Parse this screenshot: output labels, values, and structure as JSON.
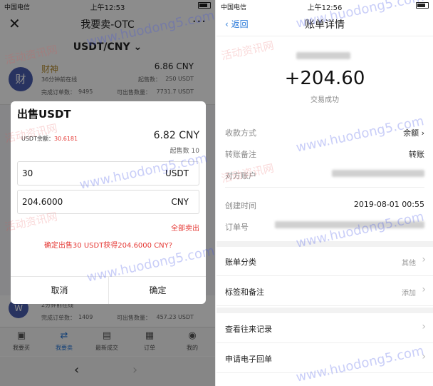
{
  "left": {
    "status": {
      "carrier": "中国电信",
      "time": "上午12:53"
    },
    "header": {
      "title": "我要卖-OTC",
      "pair": "USDT/CNY"
    },
    "list": [
      {
        "avatar": "财",
        "name": "财神",
        "seen": "36分钟前在线",
        "price": "6.86 CNY",
        "min_label": "起售数：",
        "min": "250 USDT",
        "orders_label": "完成订单数：",
        "orders": "9495",
        "qty_label": "可出售数量：",
        "qty": "7731.7 USDT"
      },
      {
        "avatar": "W",
        "name": "",
        "seen": "2分钟前在线",
        "price": "",
        "min_label": "",
        "min": "",
        "orders_label": "完成订单数：",
        "orders": "1409",
        "qty_label": "可出售数量：",
        "qty": "457.23 USDT"
      }
    ],
    "dialog": {
      "title": "出售USDT",
      "balance_label": "USDT余额：",
      "balance": "30.6181",
      "price": "6.82 CNY",
      "min": "起售数 10",
      "qty_value": "30",
      "qty_unit": "USDT",
      "cny_value": "204.6000",
      "cny_unit": "CNY",
      "sell_all": "全部卖出",
      "confirm": "确定出售30 USDT获得204.6000 CNY?",
      "cancel": "取消",
      "ok": "确定"
    },
    "tabs": [
      {
        "label": "我要买",
        "icon": "bag-icon"
      },
      {
        "label": "我要卖",
        "icon": "exchange-icon",
        "active": true
      },
      {
        "label": "最新成交",
        "icon": "receipt-icon"
      },
      {
        "label": "订单",
        "icon": "document-icon"
      },
      {
        "label": "我的",
        "icon": "person-icon"
      }
    ]
  },
  "right": {
    "status": {
      "carrier": "中国电信",
      "time": "上午12:56"
    },
    "header": {
      "back": "返回",
      "title": "账单详情"
    },
    "amount": "+204.60",
    "amount_status": "交易成功",
    "details": [
      {
        "key": "收款方式",
        "value": "余额"
      },
      {
        "key": "转账备注",
        "value": "转账"
      },
      {
        "key": "对方账户",
        "value": ""
      },
      {
        "key": "创建时间",
        "value": "2019-08-01 00:55"
      },
      {
        "key": "订单号",
        "value": ""
      }
    ],
    "menu": [
      {
        "key": "账单分类",
        "value": "其他"
      },
      {
        "key": "标签和备注",
        "value": "添加"
      },
      {
        "key": "查看往来记录",
        "value": ""
      },
      {
        "key": "申请电子回单",
        "value": ""
      }
    ]
  },
  "watermark": {
    "text": "www.huodong5.com",
    "cn": "活动资讯网"
  }
}
